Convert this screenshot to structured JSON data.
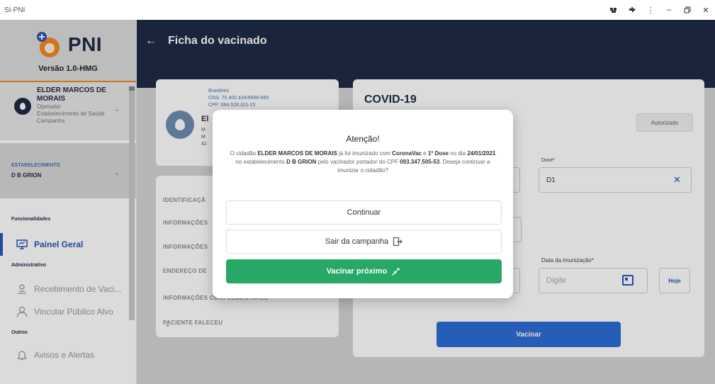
{
  "window": {
    "title": "SI-PNI",
    "controls": [
      "puzzle-icon",
      "extension-icon",
      "more-icon",
      "minimize-icon",
      "restore-icon",
      "close-icon"
    ]
  },
  "sidebar": {
    "logo_text": "PNI",
    "version": "Versão 1.0-HMG",
    "user": {
      "name": "ELDER MARCOS DE MORAIS",
      "role": "Operador",
      "establishment": "Estabelecimento de Saúde Campanha"
    },
    "estab": {
      "label": "ESTABELECIMENTO",
      "value": "D B GRION"
    },
    "sections": {
      "funcionalidades": "Funcionalidades",
      "administrativo": "Administrativo",
      "outros": "Outros"
    },
    "items": {
      "painel_geral": "Painel Geral",
      "recebimento": "Recebimento de Vaci...",
      "vincular": "Vincular Público Alvo",
      "avisos": "Avisos e Alertas"
    }
  },
  "header": {
    "title": "Ficha do vacinado"
  },
  "patient": {
    "nationality": "Brasileiro",
    "cns": "CNS: 70.400.434/9588-865",
    "cpf": "CPF: 694.528.311-15",
    "name_initial": "El",
    "line_a": "M",
    "line_b": "M",
    "line_c": "42"
  },
  "accordion": {
    "identificacao": "IDENTIFICAÇÃ",
    "informacoes_1": "INFORMAÇÕES",
    "informacoes_2": "INFORMAÇÕES",
    "endereco": "ENDEREÇO DE",
    "informacoes_comp": "INFORMAÇÕES COMPLEMENTARES",
    "paciente_faleceu": "PACIENTE FALECEU"
  },
  "vaccine_form": {
    "title": "COVID-19",
    "status_button": "Autorizado",
    "dose_label": "Dose*",
    "dose_value": "D1",
    "date_label": "Data da imunização*",
    "date_placeholder": "Digite",
    "today_button": "Hoje",
    "submit_button": "Vacinar"
  },
  "modal": {
    "title": "Atenção!",
    "message_parts": {
      "p1": "O cidadão ",
      "name": "ELDER MARCOS DE MORAIS",
      "p2": " já foi imunizado com ",
      "vaccine": "CoronaVac",
      "p3": " e ",
      "dose": "1ª Dose",
      "p4": " no dia ",
      "date": "24/01/2021",
      "p5": " no estabelecimento ",
      "estab": "D B GRION",
      "p6": " pelo vacinador portador do CPF ",
      "cpf": "093.347.505-53",
      "p7": ". Deseja continuar a imunizar o cidadão?"
    },
    "btn_continue": "Continuar",
    "btn_exit": "Sair da campanha",
    "btn_next": "Vacinar próximo"
  },
  "colors": {
    "navy": "#1f2a44",
    "orange": "#f08a24",
    "blue": "#2d6ed6",
    "green": "#27a866"
  }
}
